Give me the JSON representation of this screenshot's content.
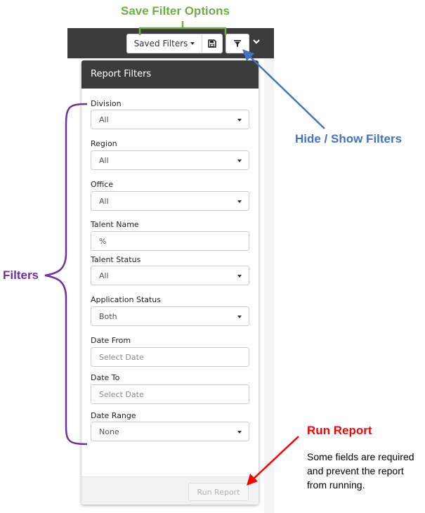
{
  "annotations": {
    "save_filter_options": "Save Filter Options",
    "hide_show_filters": "Hide / Show Filters",
    "filters": "Filters",
    "run_report": "Run Report",
    "run_report_note": [
      "Some fields are required",
      "and prevent the report",
      "from running."
    ]
  },
  "toolbar": {
    "saved_filters_label": "Saved Filters",
    "icons": {
      "saved_filters_caret": "caret-down-icon",
      "save": "floppy-disk-icon",
      "filter": "funnel-icon",
      "toggle": "chevron-down-icon"
    }
  },
  "panel": {
    "title": "Report Filters",
    "filters": [
      {
        "label": "Division",
        "type": "select",
        "value": "All"
      },
      {
        "label": "Region",
        "type": "select",
        "value": "All"
      },
      {
        "label": "Office",
        "type": "select",
        "value": "All"
      },
      {
        "label": "Talent Name",
        "type": "input",
        "value": "%"
      },
      {
        "label": "Talent Status",
        "type": "select",
        "value": "All"
      },
      {
        "label": "Application Status",
        "type": "select",
        "value": "Both"
      },
      {
        "label": "Date From",
        "type": "input",
        "placeholder": "Select Date"
      },
      {
        "label": "Date To",
        "type": "input",
        "placeholder": "Select Date"
      },
      {
        "label": "Date Range",
        "type": "select",
        "value": "None"
      }
    ],
    "run_report_label": "Run Report"
  },
  "colors": {
    "annotation_green": "#70ad47",
    "annotation_blue": "#4472c4",
    "annotation_purple": "#7030a0",
    "annotation_red": "#ff0000",
    "header_dark": "#3c3c3c"
  }
}
